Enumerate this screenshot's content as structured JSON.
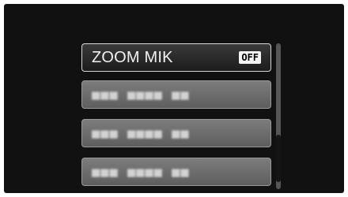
{
  "menu": {
    "items": [
      {
        "label": "ZOOM MIK",
        "value": "OFF",
        "selected": true
      },
      {
        "label": "■■■ ■■■■ ■■",
        "blurred": true
      },
      {
        "label": "■■■ ■■■■ ■■",
        "blurred": true
      },
      {
        "label": "■■■ ■■■■ ■■",
        "blurred": true
      }
    ]
  },
  "scrollbar": {
    "position": "lower-middle"
  },
  "colors": {
    "background": "#111111",
    "selected_item": "#2a2a2a",
    "dim_item": "#6d6d6d",
    "badge": "#f4f4f4"
  }
}
